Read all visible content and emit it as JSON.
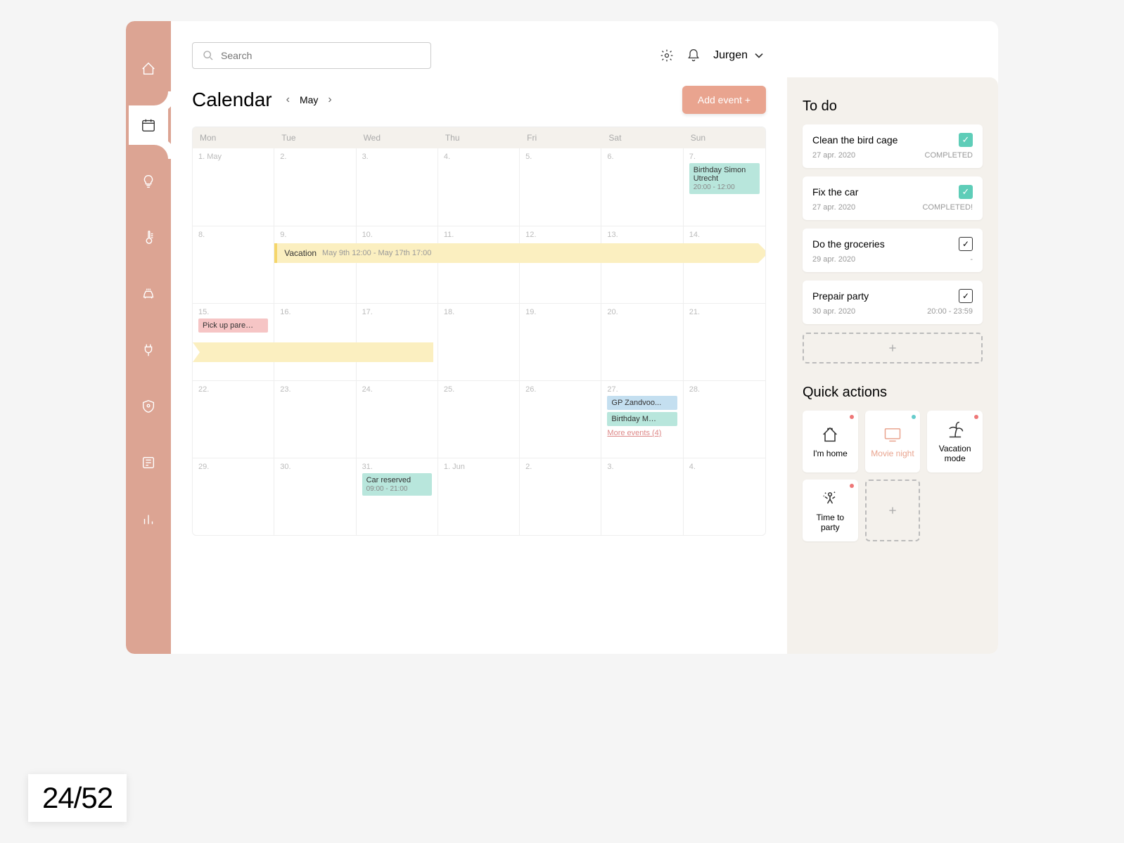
{
  "search": {
    "placeholder": "Search"
  },
  "user": {
    "name": "Jurgen"
  },
  "page": {
    "title": "Calendar",
    "month": "May",
    "add_event": "Add event +"
  },
  "days": [
    "Mon",
    "Tue",
    "Wed",
    "Thu",
    "Fri",
    "Sat",
    "Sun"
  ],
  "weeks": [
    [
      "1. May",
      "2.",
      "3.",
      "4.",
      "5.",
      "6.",
      "7."
    ],
    [
      "8.",
      "9.",
      "10.",
      "11.",
      "12.",
      "13.",
      "14."
    ],
    [
      "15.",
      "16.",
      "17.",
      "18.",
      "19.",
      "20.",
      "21."
    ],
    [
      "22.",
      "23.",
      "24.",
      "25.",
      "26.",
      "27.",
      "28."
    ],
    [
      "29.",
      "30.",
      "31.",
      "1. Jun",
      "2.",
      "3.",
      "4."
    ]
  ],
  "events": {
    "birthday_simon": {
      "title": "Birthday Simon Utrecht",
      "time": "20:00 - 12:00"
    },
    "vacation": {
      "title": "Vacation",
      "sub": "May 9th 12:00 - May 17th 17:00"
    },
    "pickup": {
      "title": "Pick up pare…"
    },
    "gp": {
      "title": "GP Zandvoo..."
    },
    "birthday_m": {
      "title": "Birthday M…"
    },
    "more": {
      "label": "More events (4)"
    },
    "car": {
      "title": "Car reserved",
      "time": "09:00 - 21:00"
    }
  },
  "todo": {
    "title": "To do",
    "items": [
      {
        "title": "Clean the bird cage",
        "date": "27 apr. 2020",
        "status": "COMPLETED",
        "done": true
      },
      {
        "title": "Fix the car",
        "date": "27 apr. 2020",
        "status": "COMPLETED!",
        "done": true
      },
      {
        "title": "Do the groceries",
        "date": "29 apr. 2020",
        "status": "-",
        "done": false
      },
      {
        "title": "Prepair party",
        "date": "30 apr. 2020",
        "status": "20:00 - 23:59",
        "done": false
      }
    ]
  },
  "quick_actions": {
    "title": "Quick actions",
    "items": [
      {
        "label": "I'm home",
        "dot": "red"
      },
      {
        "label": "Movie night",
        "dot": "teal"
      },
      {
        "label": "Vacation mode",
        "dot": "red"
      },
      {
        "label": "Time to party",
        "dot": "red"
      }
    ]
  },
  "counter": "24/52"
}
